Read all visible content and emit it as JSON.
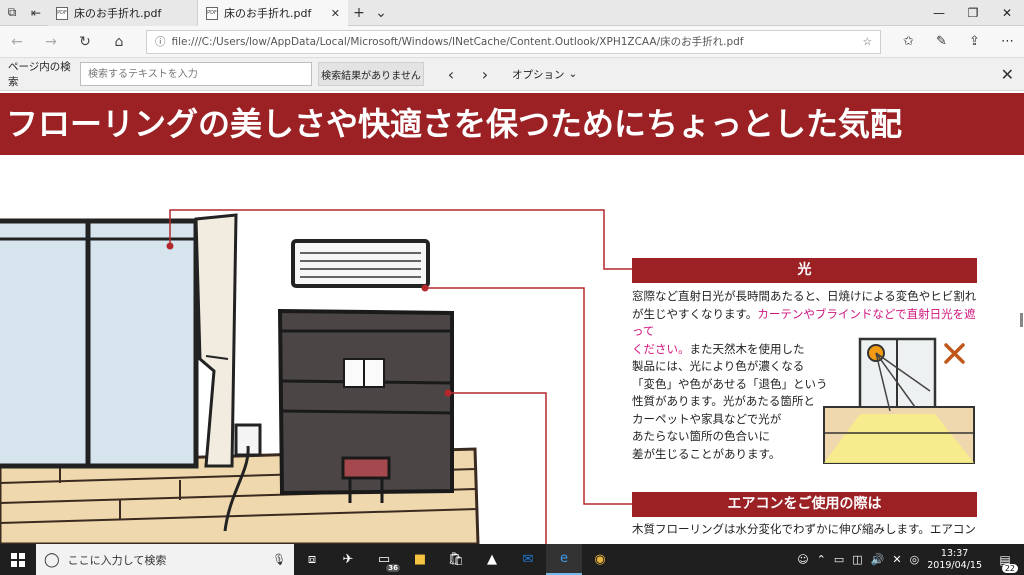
{
  "tabs": [
    {
      "title": "床のお手折れ.pdf",
      "active": false
    },
    {
      "title": "床のお手折れ.pdf",
      "active": true
    }
  ],
  "address": {
    "url": "file:///C:/Users/low/AppData/Local/Microsoft/Windows/INetCache/Content.Outlook/XPH1ZCAA/床のお手折れ.pdf"
  },
  "findbar": {
    "label": "ページ内の検索",
    "placeholder": "検索するテキストを入力",
    "result": "検索結果がありません",
    "options": "オプション"
  },
  "document": {
    "banner": "フローリングの美しさや快適さを保つためにちょっとした気配",
    "section1": {
      "heading": "光",
      "line1": "窓際など直射日光が長時間あたると、日焼けによる変色やヒビ割れ",
      "line2a": "が生じやすくなります。",
      "line2b": "カーテンやブラインドなどで直射日光を遮って",
      "line3a": "ください。",
      "line3b": "また天然木を使用した",
      "line4": "製品には、光により色が濃くなる",
      "line5": "「変色」や色があせる「退色」という",
      "line6": "性質があります。光があたる箇所と",
      "line7": "カーペットや家具などで光が",
      "line8": "あたらない箇所の色合いに",
      "line9": "差が生じることがあります。"
    },
    "section2": {
      "heading": "エアコンをご使用の際は",
      "line1": "木質フローリングは水分変化でわずかに伸び縮みします。エアコン"
    }
  },
  "taskbar": {
    "search_placeholder": "ここに入力して検索",
    "badge": "36",
    "time": "13:37",
    "date": "2019/04/15",
    "notifications": "22"
  },
  "colors": {
    "banner": "#9b2125",
    "highlight": "#d0157f",
    "taskbar": "#1f1f1f"
  }
}
